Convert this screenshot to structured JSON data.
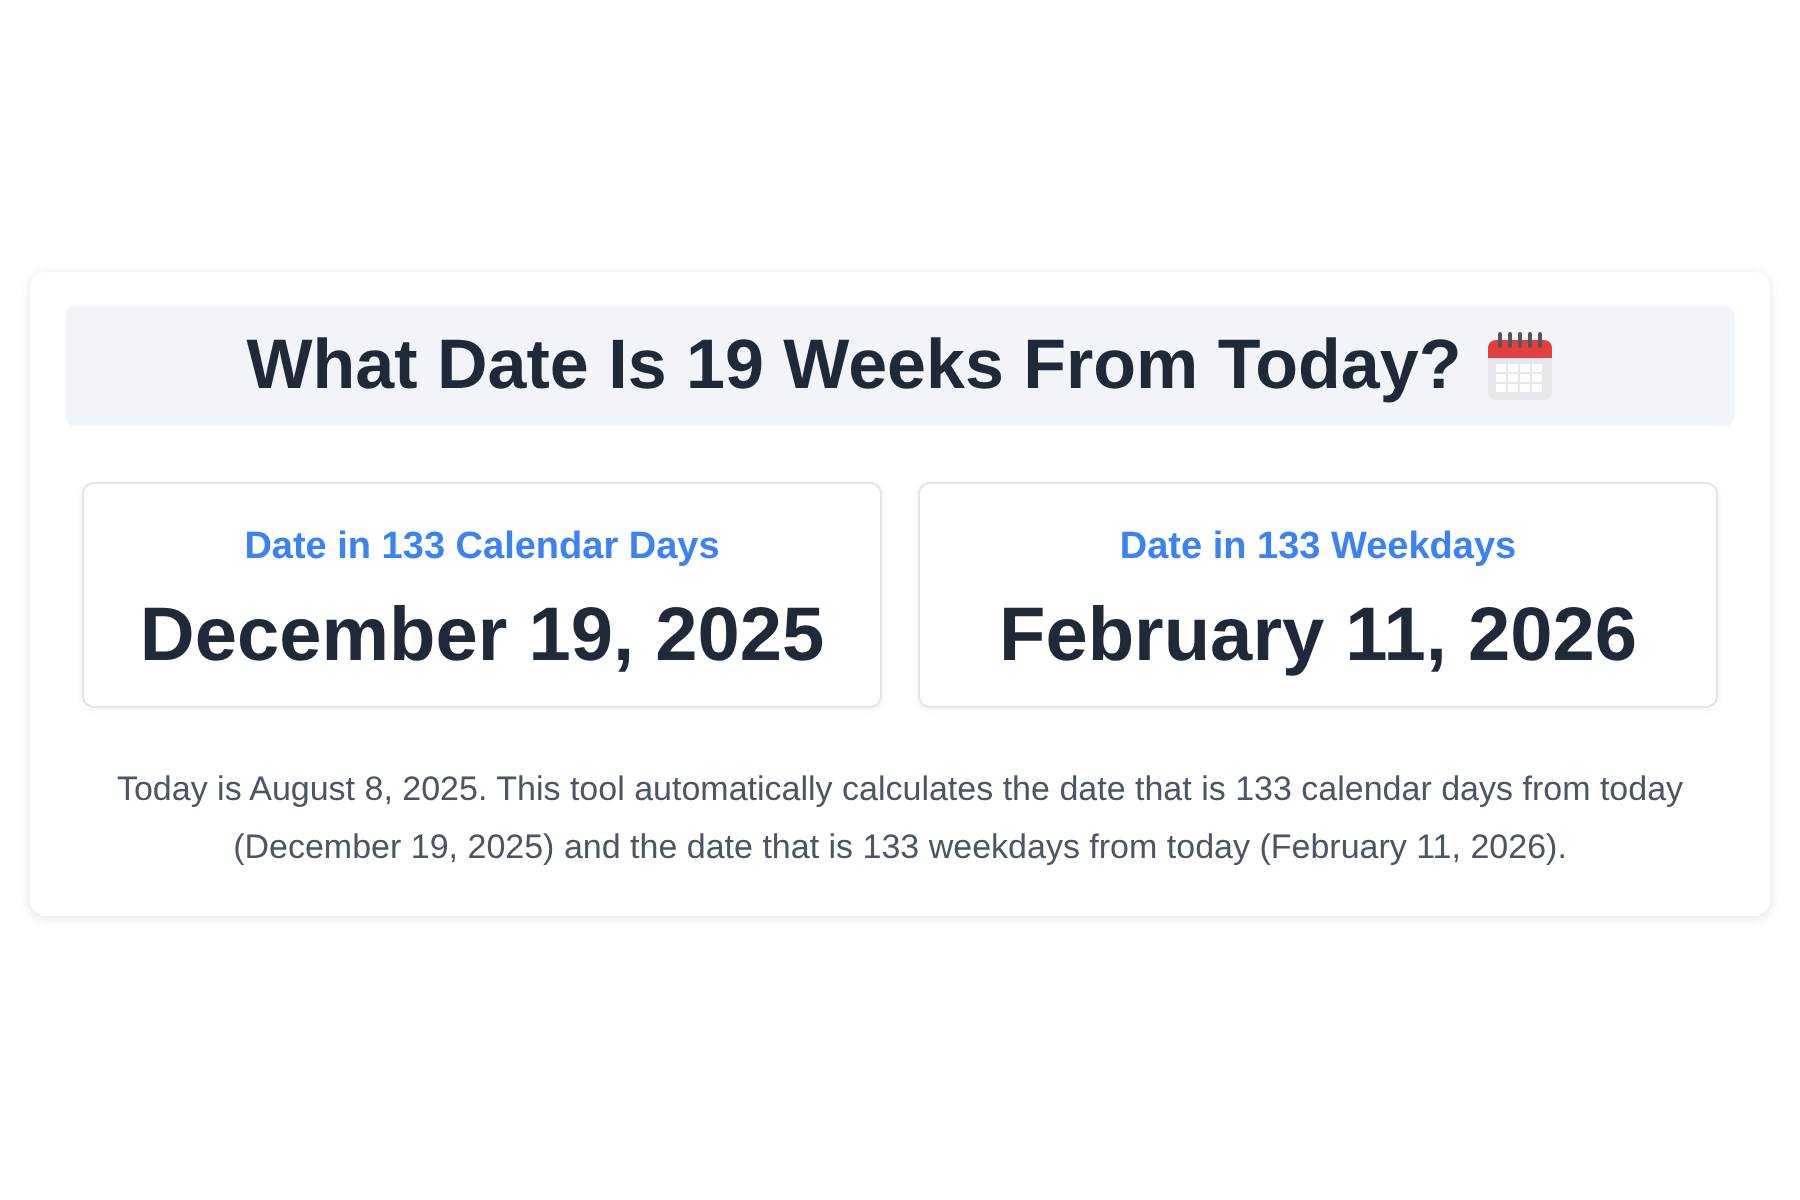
{
  "title": "What Date Is 19 Weeks From Today?",
  "results": [
    {
      "label": "Date in 133 Calendar Days",
      "date": "December 19, 2025"
    },
    {
      "label": "Date in 133 Weekdays",
      "date": "February 11, 2026"
    }
  ],
  "description": "Today is August 8, 2025. This tool automatically calculates the date that is 133 calendar days from today (December 19, 2025) and the date that is 133 weekdays from today (February 11, 2026)."
}
